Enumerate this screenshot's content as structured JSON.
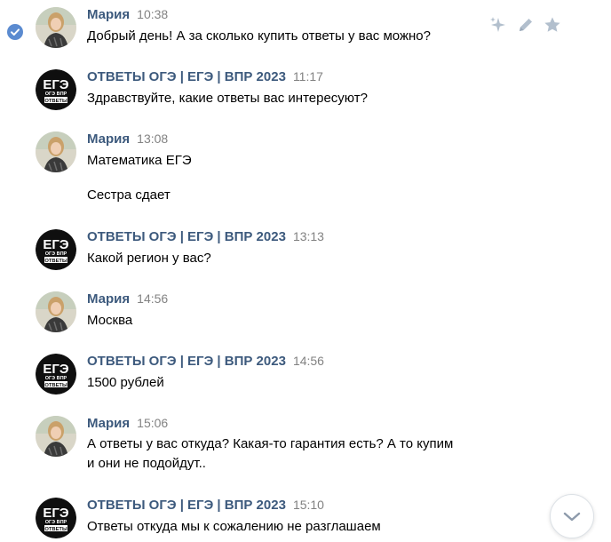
{
  "messages": [
    {
      "author": "Мария",
      "time": "10:38",
      "avatar": "user-photo-avatar",
      "lines": [
        "Добрый день! А за сколько купить ответы у вас можно?"
      ]
    },
    {
      "author": "ОТВЕТЫ ОГЭ | ЕГЭ | ВПР 2023",
      "time": "11:17",
      "avatar": "group-logo-avatar",
      "lines": [
        "Здравствуйте, какие ответы вас интересуют?"
      ]
    },
    {
      "author": "Мария",
      "time": "13:08",
      "avatar": "user-photo-avatar",
      "lines": [
        "Математика ЕГЭ",
        "Сестра сдает"
      ]
    },
    {
      "author": "ОТВЕТЫ ОГЭ | ЕГЭ | ВПР 2023",
      "time": "13:13",
      "avatar": "group-logo-avatar",
      "lines": [
        "Какой регион у вас?"
      ]
    },
    {
      "author": "Мария",
      "time": "14:56",
      "avatar": "user-photo-avatar",
      "lines": [
        "Москва"
      ]
    },
    {
      "author": "ОТВЕТЫ ОГЭ | ЕГЭ | ВПР 2023",
      "time": "14:56",
      "avatar": "group-logo-avatar",
      "lines": [
        "1500 рублей"
      ]
    },
    {
      "author": "Мария",
      "time": "15:06",
      "avatar": "user-photo-avatar",
      "lines": [
        "А ответы у вас откуда? Какая-то гарантия есть? А то купим",
        "и они не подойдут.."
      ]
    },
    {
      "author": "ОТВЕТЫ ОГЭ | ЕГЭ | ВПР 2023",
      "time": "15:10",
      "avatar": "group-logo-avatar",
      "lines": [
        "Ответы откуда мы к сожалению не разглашаем"
      ]
    }
  ],
  "logo": {
    "big": "ЕГЭ",
    "small": "ОГЭ ВПР",
    "bottom": "ОТВЕТЫ"
  },
  "icons": {
    "selected": "check-icon",
    "actions": [
      "sparkle-icon",
      "pencil-icon",
      "star-icon"
    ],
    "scroll": "chevron-down-icon"
  },
  "colors": {
    "author": "#3d5a7d",
    "time": "#828282",
    "text": "#000000",
    "check": "#5b8bd0",
    "action_icon": "#b2bfcd"
  }
}
